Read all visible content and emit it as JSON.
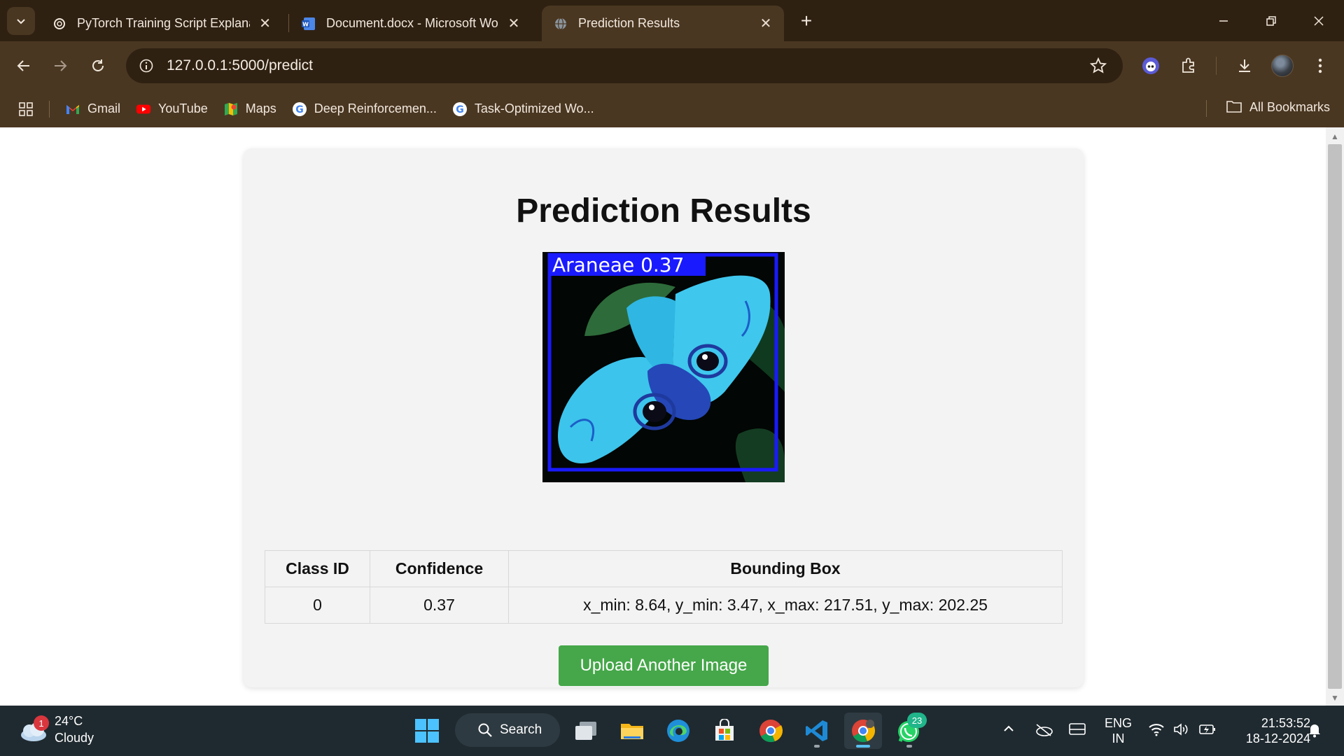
{
  "browser": {
    "tabs": [
      {
        "title": "PyTorch Training Script Explanat",
        "icon": "openai-icon",
        "active": false
      },
      {
        "title": "Document.docx - Microsoft Wo",
        "icon": "word-icon",
        "active": false
      },
      {
        "title": "Prediction Results",
        "icon": "globe-icon",
        "active": true
      }
    ],
    "address": "127.0.0.1:5000/predict",
    "bookmarks": [
      {
        "label": "Gmail",
        "icon": "gmail-icon"
      },
      {
        "label": "YouTube",
        "icon": "youtube-icon"
      },
      {
        "label": "Maps",
        "icon": "maps-icon"
      },
      {
        "label": "Deep Reinforcemen...",
        "icon": "google-icon"
      },
      {
        "label": "Task-Optimized Wo...",
        "icon": "google-icon"
      }
    ],
    "all_bookmarks_label": "All Bookmarks"
  },
  "page": {
    "title": "Prediction Results",
    "image_label": "Araneae  0.37",
    "table": {
      "headers": [
        "Class ID",
        "Confidence",
        "Bounding Box"
      ],
      "rows": [
        [
          "0",
          "0.37",
          "x_min: 8.64, y_min: 3.47, x_max: 217.51, y_max: 202.25"
        ]
      ]
    },
    "upload_button": "Upload Another Image"
  },
  "taskbar": {
    "weather": {
      "temp": "24°C",
      "condition": "Cloudy",
      "badge": "1"
    },
    "search_label": "Search",
    "whatsapp_badge": "23",
    "lang_line1": "ENG",
    "lang_line2": "IN",
    "time": "21:53:52",
    "date": "18-12-2024"
  },
  "colors": {
    "chrome_dark": "#2f2112",
    "chrome_toolbar": "#4a3722",
    "button_green": "#45a749",
    "taskbar": "#1f2a30"
  }
}
